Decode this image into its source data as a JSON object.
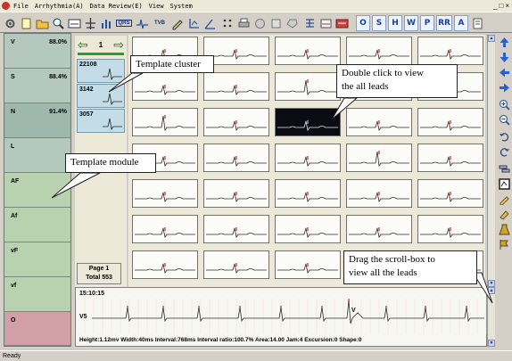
{
  "menu": {
    "items": [
      "File",
      "Arrhythmia(A)",
      "Data Review(E)",
      "View",
      "System"
    ],
    "window_controls": [
      "_",
      "□",
      "×"
    ]
  },
  "toolbar": {
    "icons": [
      "settings-icon",
      "open-file-icon",
      "open-folder-icon",
      "zoom-icon",
      "report-icon",
      "measure-icon",
      "bar-chart-icon",
      "qrs-icon",
      "waveform-icon",
      "tvb-icon",
      "edit-icon",
      "axis-icon",
      "angle-icon",
      "dots-icon",
      "print-icon",
      "copy-icon",
      "cut-icon",
      "paste-icon",
      "network-icon",
      "equalizer-icon",
      "display-icon"
    ],
    "qrs_label": "QRS",
    "tvb_label": "TVB",
    "letter_buttons": [
      "O",
      "S",
      "H",
      "W",
      "P",
      "RR",
      "A"
    ]
  },
  "modules": [
    {
      "name": "V",
      "pct": "88.0%",
      "color": "#b4c8be"
    },
    {
      "name": "S",
      "pct": "88.4%",
      "color": "#b4c8be"
    },
    {
      "name": "N",
      "pct": "91.4%",
      "color": "#9fb8ae"
    },
    {
      "name": "L",
      "pct": "",
      "color": "#b4c8be"
    },
    {
      "name": "AF",
      "pct": "",
      "color": "#b8d2b0"
    },
    {
      "name": "Af",
      "pct": "",
      "color": "#b8d2b0"
    },
    {
      "name": "vF",
      "pct": "",
      "color": "#b8d2b0"
    },
    {
      "name": "vf",
      "pct": "",
      "color": "#b8d2b0"
    },
    {
      "name": "O",
      "pct": "",
      "color": "#d4a0a8"
    }
  ],
  "clusters": {
    "nav_left": "⇦",
    "nav_page": "1",
    "nav_right": "⇨",
    "items": [
      {
        "count": "22108"
      },
      {
        "count": "3142"
      },
      {
        "count": "3057"
      }
    ]
  },
  "page_info": {
    "page": "Page 1",
    "total": "Total 553"
  },
  "strip": {
    "time": "15:10:15",
    "lead": "V5",
    "beat_marker": "V",
    "params": "Height:1.12mv  Width:40ms  Interval:768ms  Interval ratio:100.7%  Area:14.00  Jam:4  Excursion:0  Shape:0"
  },
  "status": "Ready",
  "callouts": {
    "template_cluster": "Template cluster",
    "double_click": "Double click to view the all leads",
    "double_click_line1": "Double  click  to  view",
    "double_click_line2": "the all leads",
    "template_module": "Template module",
    "drag_line1": "Drag  the  scroll-box  to",
    "drag_line2": "view all the leads"
  },
  "right_tools": [
    "up-arrow-icon",
    "down-arrow-icon",
    "left-arrow-icon",
    "right-arrow-icon",
    "zoom-in-icon",
    "zoom-out-icon",
    "undo-icon",
    "redo-icon",
    "layers-icon",
    "chart-frame-icon",
    "pencil-icon",
    "marker-icon",
    "flask-icon",
    "flag-icon"
  ],
  "colors": {
    "accent": "#1a3fa0",
    "selected_cell": "#0b0b14",
    "trace": "#2a2a2a",
    "marker": "#d02020"
  }
}
